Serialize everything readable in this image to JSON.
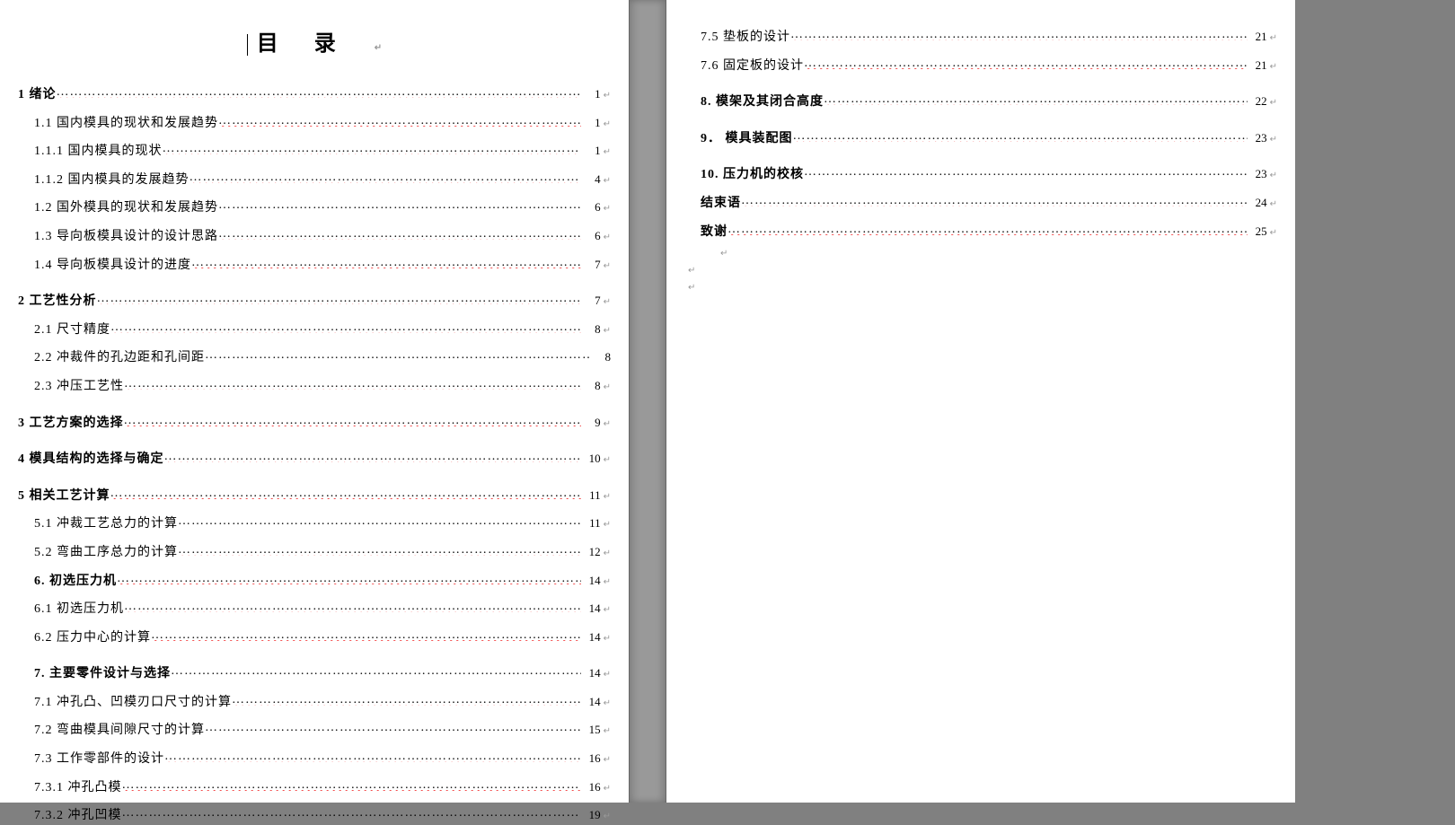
{
  "title": "目录",
  "toc_left": [
    {
      "num": "1",
      "label": "绪论",
      "page": "1",
      "bold": true,
      "indent": 0,
      "wavy_dots": true
    },
    {
      "num": "1.1",
      "label": "国内模具的现状和发展趋势",
      "page": "1",
      "bold": false,
      "indent": 1,
      "wavy_dots": true
    },
    {
      "num": "1.1.1",
      "label": "国内模具的现状",
      "page": "1",
      "bold": false,
      "indent": 1,
      "wavy_dots": true
    },
    {
      "num": "1.1.2",
      "label": "国内模具的发展趋势",
      "page": "4",
      "bold": false,
      "indent": 1,
      "wavy_dots": true
    },
    {
      "num": "1.2",
      "label": "国外模具的现状和发展趋势",
      "page": "6",
      "bold": false,
      "indent": 1,
      "wavy_dots": true
    },
    {
      "num": "1.3",
      "label": "导向板模具设计的设计思路",
      "page": "6",
      "bold": false,
      "indent": 1,
      "wavy_dots": true
    },
    {
      "num": "1.4",
      "label": "导向板模具设计的进度",
      "page": "7",
      "bold": false,
      "indent": 1,
      "wavy_dots": true
    },
    {
      "num": "2",
      "label": "工艺性分析",
      "page": "7",
      "bold": true,
      "indent": 0,
      "wavy_dots": true,
      "gap": true
    },
    {
      "num": "2.1",
      "label": "尺寸精度",
      "page": "8",
      "bold": false,
      "indent": 1,
      "wavy_dots": true
    },
    {
      "num": "2.2",
      "label": "冲裁件的孔边距和孔间距",
      "page": "8",
      "bold": false,
      "indent": 1,
      "wavy_dots": true,
      "no_ret": true
    },
    {
      "num": "2.3",
      "label": "冲压工艺性",
      "page": "8",
      "bold": false,
      "indent": 1,
      "wavy_dots": true
    },
    {
      "num": "3",
      "label": "工艺方案的选择",
      "page": "9",
      "bold": true,
      "indent": 0,
      "wavy_dots": true,
      "gap": true
    },
    {
      "num": "4",
      "label": "模具结构的选择与确定",
      "page": "10",
      "bold": true,
      "indent": 0,
      "wavy_dots": true,
      "gap": true
    },
    {
      "num": "5",
      "label": "相关工艺计算",
      "page": "11",
      "bold": true,
      "indent": 0,
      "wavy_dots": true,
      "gap": true
    },
    {
      "num": "5.1",
      "label": "冲裁工艺总力的计算",
      "page": "11",
      "bold": false,
      "indent": 2,
      "wavy_dots": true
    },
    {
      "num": "5.2",
      "label": "弯曲工序总力的计算",
      "page": "12",
      "bold": false,
      "indent": 2,
      "wavy_dots": true
    },
    {
      "num": "6.",
      "label": "初选压力机",
      "page": "14",
      "bold": true,
      "indent": 2,
      "wavy_dots": true
    },
    {
      "num": "6.1",
      "label": "初选压力机",
      "page": "14",
      "bold": false,
      "indent": 2,
      "wavy_dots": true
    },
    {
      "num": "6.2",
      "label": "压力中心的计算",
      "page": "14",
      "bold": false,
      "indent": 2,
      "wavy_dots": true
    },
    {
      "num": "7.",
      "label": "主要零件设计与选择",
      "page": "14",
      "bold": true,
      "indent": 1,
      "wavy_dots": true,
      "gap": true
    },
    {
      "num": "7.1",
      "label": "冲孔凸、凹模刃口尺寸的计算",
      "page": "14",
      "bold": false,
      "indent": 2,
      "wavy_dots": true
    },
    {
      "num": "7.2",
      "label": "弯曲模具间隙尺寸的计算",
      "page": "15",
      "bold": false,
      "indent": 2,
      "wavy_dots": true
    },
    {
      "num": "7.3",
      "label": "工作零部件的设计",
      "page": "16",
      "bold": false,
      "indent": 2,
      "wavy_dots": true
    },
    {
      "num": "7.3.1",
      "label": "冲孔凸模",
      "page": "16",
      "bold": false,
      "indent": 2,
      "wavy_dots": true
    },
    {
      "num": "7.3.2",
      "label": "冲孔凹模",
      "page": "19",
      "bold": false,
      "indent": 2,
      "wavy_dots": true
    }
  ],
  "toc_right": [
    {
      "num": "7.5",
      "label": "垫板的设计",
      "page": "21",
      "bold": false,
      "indent": 2,
      "wavy_dots": true
    },
    {
      "num": "7.6",
      "label": "固定板的设计",
      "page": "21",
      "bold": false,
      "indent": 2,
      "wavy_dots": true
    },
    {
      "num": "8.",
      "label": "模架及其闭合高度",
      "page": "22",
      "bold": true,
      "indent": 1,
      "wavy_dots": true,
      "gap": true
    },
    {
      "num": "9．",
      "label": "模具装配图",
      "page": "23",
      "bold": true,
      "indent": 1,
      "wavy_dots": true,
      "gap": true
    },
    {
      "num": "10.",
      "label": "压力机的校核",
      "page": "23",
      "bold": true,
      "indent": 1,
      "wavy_dots": true,
      "gap": true
    },
    {
      "num": "",
      "label": "结束语",
      "page": "24",
      "bold": true,
      "indent": 2,
      "wavy_dots": true
    },
    {
      "num": "",
      "label": "致谢",
      "page": "25",
      "bold": true,
      "indent": 2,
      "wavy_dots": true
    }
  ],
  "ret_mark": "↵"
}
